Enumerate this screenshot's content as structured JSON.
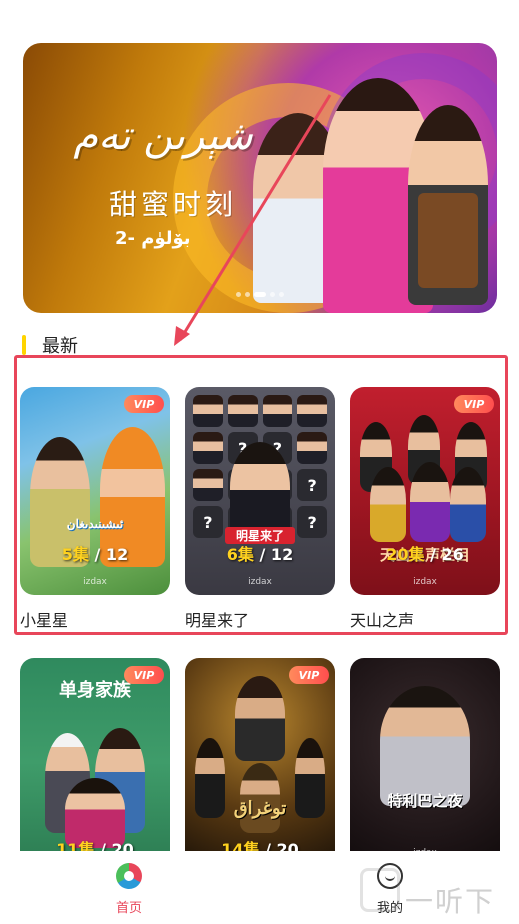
{
  "banner": {
    "uyghur_title": "شېرىن تەم",
    "chinese_title": "甜蜜时刻",
    "episode_text": "2- بۆلۈم",
    "dots": 5,
    "active_dot": 2
  },
  "section": {
    "title": "最新"
  },
  "cards": [
    {
      "title": "小星星",
      "ep_num": "5",
      "ep_unit": "集",
      "ep_total": "/ 12",
      "vip": "VIP",
      "brand": "izdax",
      "overlay": "ئىشىنىدىغان"
    },
    {
      "title": "明星来了",
      "ep_num": "6",
      "ep_unit": "集",
      "ep_total": "/ 12",
      "vip": "",
      "brand": "izdax",
      "overlay": "明星来了"
    },
    {
      "title": "天山之声",
      "ep_num": "20",
      "ep_unit": "集",
      "ep_total": "/ 26",
      "vip": "VIP",
      "brand": "izdax",
      "overlay": "天山之声栏目"
    },
    {
      "title": "",
      "ep_num": "11",
      "ep_unit": "集",
      "ep_total": "/ 20",
      "vip": "VIP",
      "brand": "",
      "overlay": "单身家族"
    },
    {
      "title": "",
      "ep_num": "14",
      "ep_unit": "集",
      "ep_total": "/ 20",
      "vip": "VIP",
      "brand": "",
      "overlay": "توغراق"
    },
    {
      "title": "",
      "ep_num": "",
      "ep_unit": "",
      "ep_total": "",
      "vip": "",
      "brand": "izdax",
      "overlay": "特利巴之夜"
    }
  ],
  "nav": {
    "home_label": "首页",
    "me_label": "我的"
  },
  "watermark": "一听下载",
  "colors": {
    "accent": "#e8465a",
    "section_bar": "#ffd400",
    "episode_highlight": "#ffd21f"
  }
}
